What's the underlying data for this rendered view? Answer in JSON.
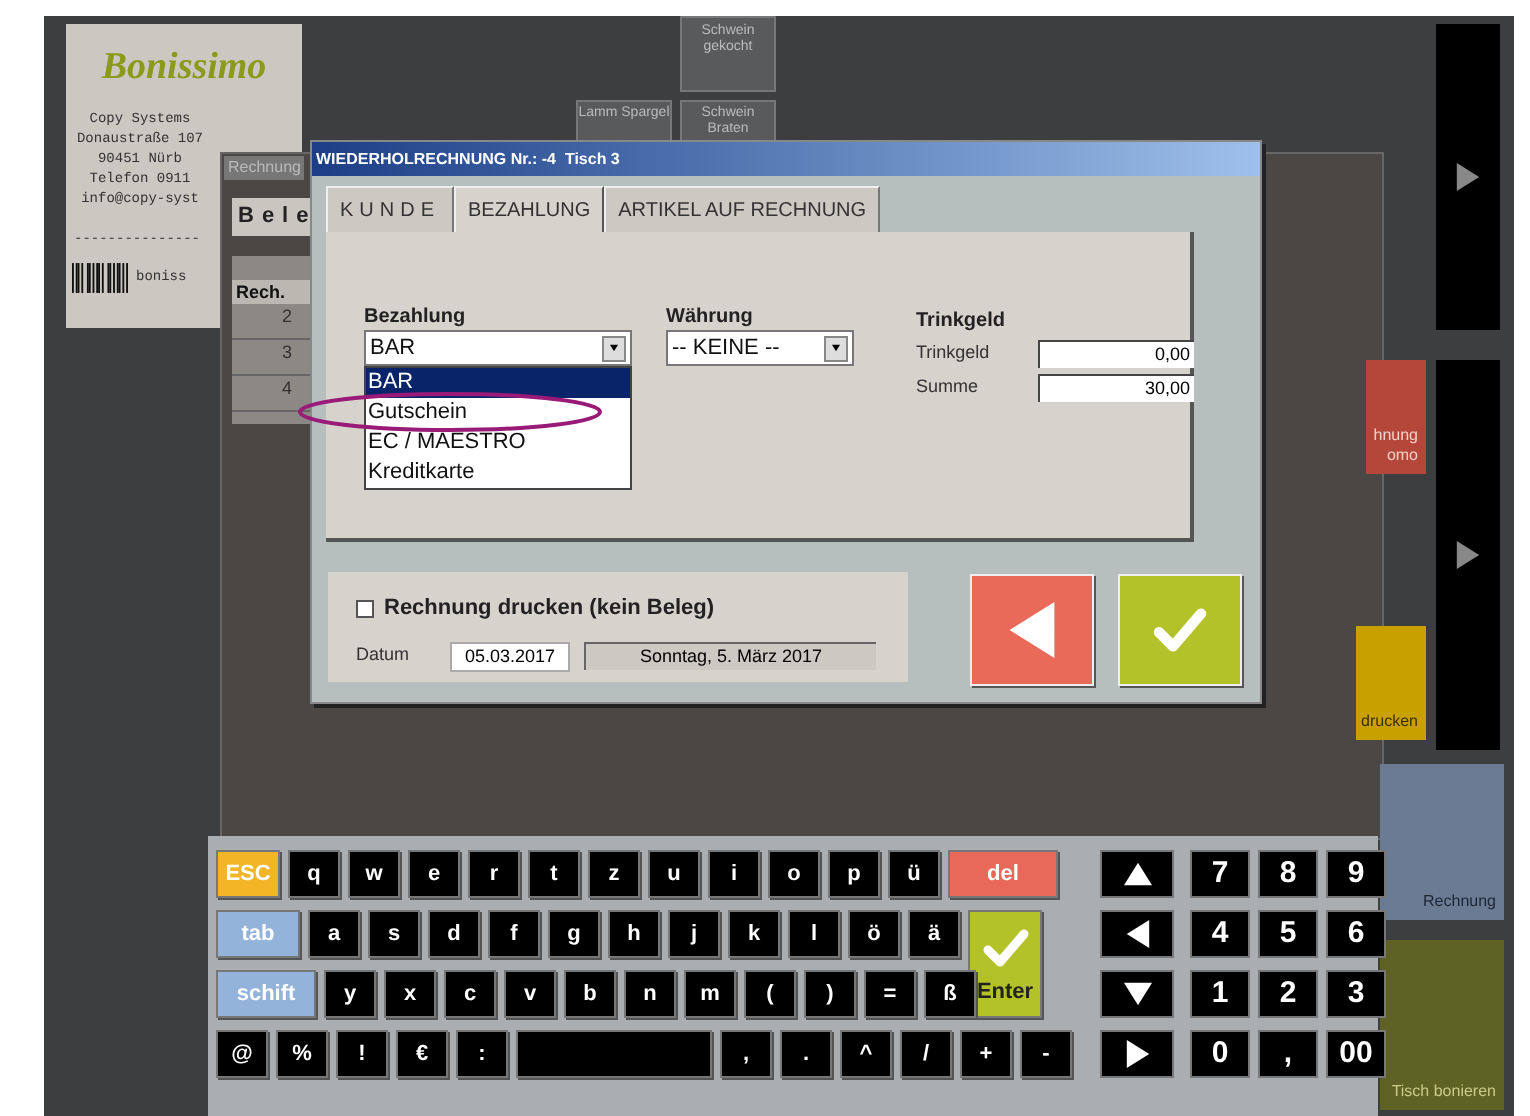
{
  "receipt": {
    "logo": "Bonissimo",
    "lines": [
      "Copy Systems",
      "Donaustraße 107",
      "90451 Nürb",
      "Telefon 0911",
      "info@copy-syst"
    ],
    "separator": "---------------",
    "footer": "boniss"
  },
  "product_buttons": [
    {
      "label": "Schwein gekocht",
      "kind": "tall"
    },
    {
      "label": "Lamm Spargel",
      "kind": "short"
    },
    {
      "label": "Schwein Braten",
      "kind": "short"
    }
  ],
  "back_window": {
    "tab": "Rechnung",
    "heading": "Bele",
    "column": "Rech.",
    "rows": [
      "2",
      "3",
      "4"
    ]
  },
  "side_buttons": [
    {
      "label": "hnung omo",
      "kind": "storno"
    },
    {
      "label": "drucken",
      "kind": "print"
    },
    {
      "label": "Rechnung",
      "kind": "bill"
    },
    {
      "label": "Tisch bonieren",
      "kind": "table"
    }
  ],
  "dialog": {
    "title": "WIEDERHOLRECHNUNG Nr.: -4  Tisch 3",
    "tabs": [
      {
        "label": "KUNDE",
        "selected": false
      },
      {
        "label": "BEZAHLUNG",
        "selected": true
      },
      {
        "label": "ARTIKEL AUF RECHNUNG",
        "selected": false
      }
    ],
    "payment": {
      "label": "Bezahlung",
      "value": "BAR",
      "expanded": true,
      "options": [
        {
          "label": "BAR",
          "selected": true
        },
        {
          "label": "Gutschein",
          "selected": false
        },
        {
          "label": "EC / MAESTRO",
          "selected": false
        },
        {
          "label": "Kreditkarte",
          "selected": false
        }
      ]
    },
    "currency": {
      "label": "Währung",
      "value": "-- KEINE --"
    },
    "tip": {
      "heading": "Trinkgeld",
      "fields": [
        {
          "label": "Trinkgeld",
          "value": "0,00"
        },
        {
          "label": "Summe",
          "value": "30,00"
        }
      ]
    },
    "print_receipt": {
      "label": "Rechnung drucken (kein Beleg)",
      "checked": false
    },
    "date": {
      "label": "Datum",
      "value": "05.03.2017",
      "weekday": "Sonntag, 5. März 2017"
    }
  },
  "keyboard": {
    "rows": [
      {
        "keys": [
          {
            "label": "ESC",
            "kind": "esc"
          },
          {
            "label": "q",
            "kind": "char"
          },
          {
            "label": "w",
            "kind": "char"
          },
          {
            "label": "e",
            "kind": "char"
          },
          {
            "label": "r",
            "kind": "char"
          },
          {
            "label": "t",
            "kind": "char"
          },
          {
            "label": "z",
            "kind": "char"
          },
          {
            "label": "u",
            "kind": "char"
          },
          {
            "label": "i",
            "kind": "char"
          },
          {
            "label": "o",
            "kind": "char"
          },
          {
            "label": "p",
            "kind": "char"
          },
          {
            "label": "ü",
            "kind": "char"
          },
          {
            "label": "del",
            "kind": "del"
          }
        ]
      },
      {
        "keys": [
          {
            "label": "tab",
            "kind": "tab"
          },
          {
            "label": "a",
            "kind": "char"
          },
          {
            "label": "s",
            "kind": "char"
          },
          {
            "label": "d",
            "kind": "char"
          },
          {
            "label": "f",
            "kind": "char"
          },
          {
            "label": "g",
            "kind": "char"
          },
          {
            "label": "h",
            "kind": "char"
          },
          {
            "label": "j",
            "kind": "char"
          },
          {
            "label": "k",
            "kind": "char"
          },
          {
            "label": "l",
            "kind": "char"
          },
          {
            "label": "ö",
            "kind": "char"
          },
          {
            "label": "ä",
            "kind": "char"
          },
          {
            "label": "Enter",
            "kind": "enter"
          }
        ]
      },
      {
        "keys": [
          {
            "label": "schift",
            "kind": "shift"
          },
          {
            "label": "y",
            "kind": "char"
          },
          {
            "label": "x",
            "kind": "char"
          },
          {
            "label": "c",
            "kind": "char"
          },
          {
            "label": "v",
            "kind": "char"
          },
          {
            "label": "b",
            "kind": "char"
          },
          {
            "label": "n",
            "kind": "char"
          },
          {
            "label": "m",
            "kind": "char"
          },
          {
            "label": "(",
            "kind": "char"
          },
          {
            "label": ")",
            "kind": "char"
          },
          {
            "label": "=",
            "kind": "char"
          },
          {
            "label": "ß",
            "kind": "char"
          }
        ]
      },
      {
        "keys": [
          {
            "label": "@",
            "kind": "char"
          },
          {
            "label": "%",
            "kind": "char"
          },
          {
            "label": "!",
            "kind": "char"
          },
          {
            "label": "€",
            "kind": "char"
          },
          {
            "label": ":",
            "kind": "char"
          },
          {
            "kind": "space"
          },
          {
            "label": ",",
            "kind": "char"
          },
          {
            "label": ".",
            "kind": "char"
          },
          {
            "label": "^",
            "kind": "char"
          },
          {
            "label": "/",
            "kind": "char"
          },
          {
            "label": "+",
            "kind": "char"
          },
          {
            "label": "-",
            "kind": "char"
          }
        ]
      }
    ],
    "arrows": [
      {
        "kind": "up"
      },
      {
        "kind": "left"
      },
      {
        "kind": "down"
      },
      {
        "kind": "right"
      }
    ],
    "numpad": [
      [
        "7",
        "8",
        "9"
      ],
      [
        "4",
        "5",
        "6"
      ],
      [
        "1",
        "2",
        "3"
      ],
      [
        "0",
        ",",
        "00"
      ]
    ]
  }
}
